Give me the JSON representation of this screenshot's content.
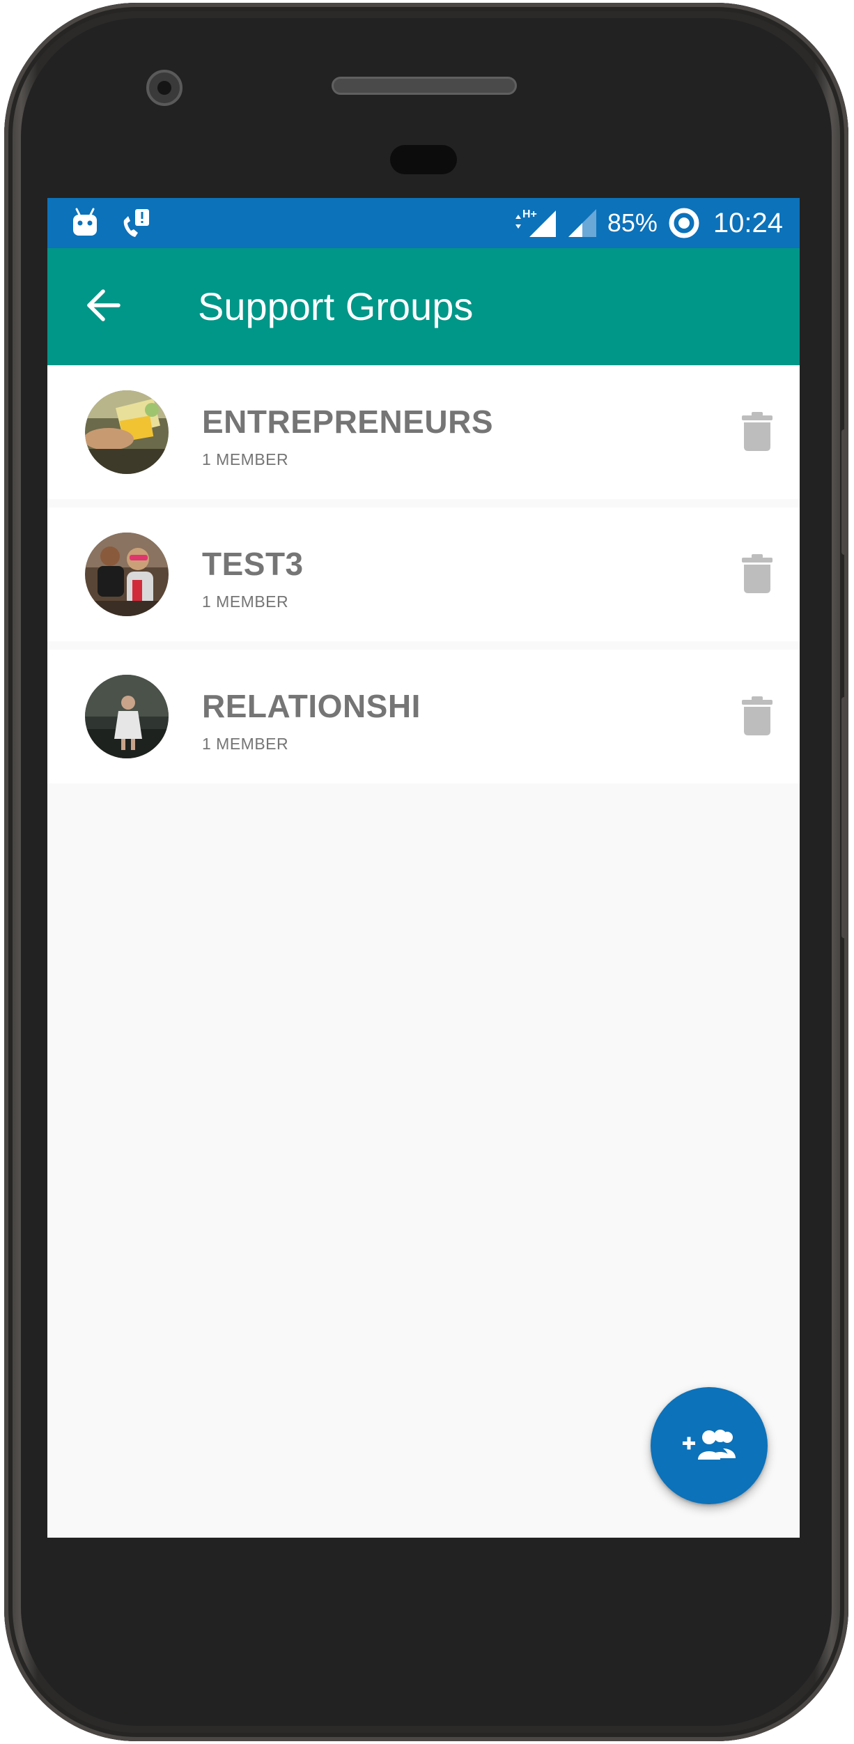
{
  "status_bar": {
    "battery_percent": "85%",
    "time": "10:24",
    "network_type": "H+",
    "icons": [
      "android-debug-icon",
      "wifi-calling-alert-icon",
      "data-arrows-icon",
      "signal-full-icon",
      "signal-partial-icon",
      "battery-ring-icon"
    ],
    "background_color": "#0c72ba"
  },
  "toolbar": {
    "title": "Support Groups",
    "back_icon": "arrow-left-icon",
    "background_color": "#009688"
  },
  "groups": [
    {
      "name": "ENTREPRENEURS",
      "members": "1 MEMBER",
      "avatar": "group-photo-avatar",
      "action_icon": "trash-icon"
    },
    {
      "name": "TEST3",
      "members": "1 MEMBER",
      "avatar": "group-photo-avatar",
      "action_icon": "trash-icon"
    },
    {
      "name": "RELATIONSHI",
      "members": "1 MEMBER",
      "avatar": "group-photo-avatar",
      "action_icon": "trash-icon"
    }
  ],
  "fab": {
    "icon": "add-group-icon",
    "background_color": "#0c72ba"
  },
  "colors": {
    "text_secondary": "#757575",
    "icon_disabled": "#bdbdbd",
    "screen_background": "#f9f9f9"
  }
}
